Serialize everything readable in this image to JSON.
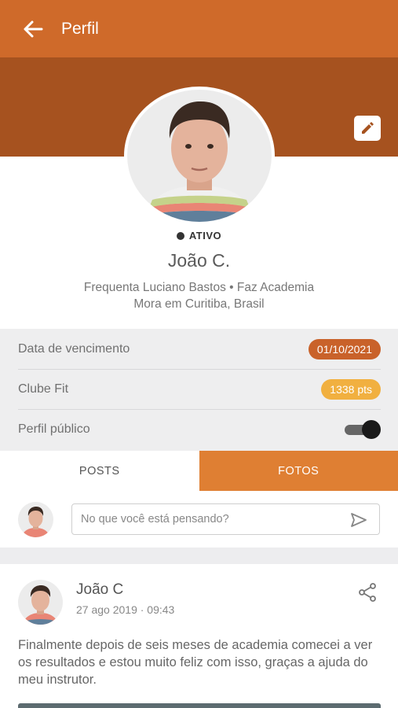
{
  "appbar": {
    "title": "Perfil",
    "back_icon": "arrow-left-icon"
  },
  "profile": {
    "edit_icon": "pencil-icon",
    "status": "ATIVO",
    "name": "João C.",
    "info_line1": "Frequenta Luciano Bastos • Faz Academia",
    "info_line2": "Mora em Curitiba, Brasil"
  },
  "details": [
    {
      "label": "Data de vencimento",
      "value": "01/10/2021"
    },
    {
      "label": "Clube Fit",
      "value": "1338 pts"
    },
    {
      "label": "Perfil público",
      "toggle_on": true
    }
  ],
  "tabs": [
    {
      "label": "POSTS",
      "active": false
    },
    {
      "label": "FOTOS",
      "active": true
    }
  ],
  "composer": {
    "placeholder": "No que você está pensando?",
    "send_icon": "send-icon"
  },
  "post": {
    "author": "João C",
    "time": "27 ago 2019 · 09:43",
    "text": "Finalmente depois de seis meses de academia comecei a ver os resultados e estou muito feliz com isso, graças a ajuda do meu instrutor.",
    "share_icon": "share-icon"
  },
  "colors": {
    "appbar": "#cf6a2a",
    "banner": "#a6521f",
    "accent_tab": "#df7f33",
    "date_pill": "#c9622a",
    "points_pill": "#f1b040"
  }
}
